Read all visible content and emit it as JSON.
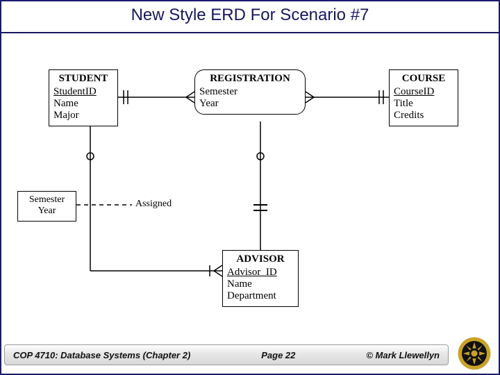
{
  "title": "New Style ERD For Scenario #7",
  "entities": {
    "student": {
      "name": "STUDENT",
      "pk": "StudentID",
      "attrs": [
        "Name",
        "Major"
      ]
    },
    "registration": {
      "name": "REGISTRATION",
      "attrs": [
        "Semester",
        "Year"
      ]
    },
    "course": {
      "name": "COURSE",
      "pk": "CourseID",
      "attrs": [
        "Title",
        "Credits"
      ]
    },
    "advisor": {
      "name": "ADVISOR",
      "pk": "Advisor_ID",
      "attrs": [
        "Name",
        "Department"
      ]
    },
    "semesteryear": {
      "lines": [
        "Semester",
        "Year"
      ]
    }
  },
  "relationships": {
    "assigned": "Assigned"
  },
  "footer": {
    "course": "COP 4710: Database Systems  (Chapter 2)",
    "page": "Page 22",
    "copyright": "© Mark Llewellyn"
  },
  "logo_color": "#c9a227"
}
